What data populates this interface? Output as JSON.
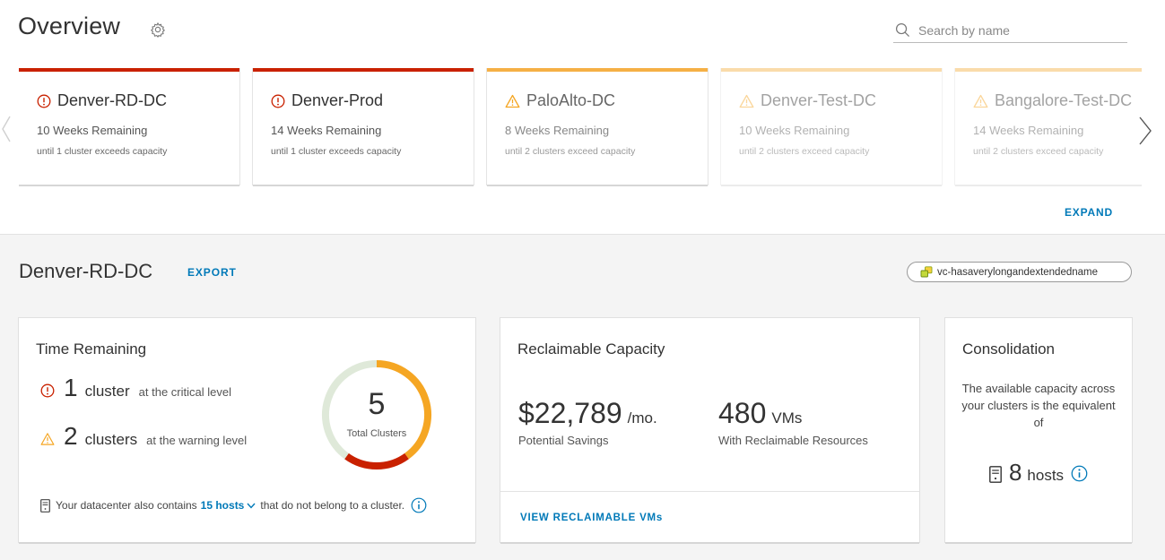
{
  "header": {
    "title": "Overview",
    "search": {
      "placeholder": "Search by name",
      "value": ""
    }
  },
  "datacenters": [
    {
      "name": "Denver-RD-DC",
      "status": "critical",
      "weeks": "10 Weeks Remaining",
      "detail": "until 1 cluster exceeds capacity"
    },
    {
      "name": "Denver-Prod",
      "status": "critical",
      "weeks": "14 Weeks Remaining",
      "detail": "until 1 cluster exceeds capacity"
    },
    {
      "name": "PaloAlto-DC",
      "status": "warning",
      "weeks": "8 Weeks Remaining",
      "detail": "until 2 clusters exceed capacity"
    },
    {
      "name": "Denver-Test-DC",
      "status": "warning",
      "weeks": "10 Weeks Remaining",
      "detail": "until 2 clusters exceed capacity"
    },
    {
      "name": "Bangalore-Test-DC",
      "status": "warning",
      "weeks": "14 Weeks Remaining",
      "detail": "until 2 clusters exceed capacity"
    }
  ],
  "expand_label": "EXPAND",
  "detail": {
    "title": "Denver-RD-DC",
    "export_label": "EXPORT",
    "vcenter_name": "vc-hasaverylongandextendedname"
  },
  "time_remaining": {
    "title": "Time Remaining",
    "critical": {
      "count": "1",
      "unit": "cluster",
      "level": "at the critical level"
    },
    "warning": {
      "count": "2",
      "unit": "clusters",
      "level": "at the warning level"
    },
    "total": "5",
    "total_label": "Total Clusters",
    "footnote_before": "Your datacenter also contains",
    "footnote_link": "15 hosts",
    "footnote_after": "that do not belong to a cluster."
  },
  "donut_segments": [
    {
      "status": "warning",
      "value": 2
    },
    {
      "status": "critical",
      "value": 1
    },
    {
      "status": "normal",
      "value": 2
    }
  ],
  "reclaimable": {
    "title": "Reclaimable Capacity",
    "savings_value": "$22,789",
    "savings_unit": "/mo.",
    "savings_label": "Potential Savings",
    "vms_value": "480",
    "vms_unit": "VMs",
    "vms_label": "With Reclaimable Resources",
    "view_label": "VIEW RECLAIMABLE VMs"
  },
  "consolidation": {
    "title": "Consolidation",
    "text": "The available capacity across your clusters is the equivalent of",
    "hosts_value": "8",
    "hosts_unit": "hosts"
  },
  "colors": {
    "critical": "#c92100",
    "warning": "#f5a623",
    "warning_border": "#f5b045",
    "normal": "#dfe9d9",
    "link": "#0079b8"
  },
  "icons": {
    "settings": "gear-icon",
    "search": "search-icon",
    "critical": "exclamation-circle-icon",
    "warning": "warning-triangle-icon",
    "next": "chevron-right-icon",
    "previous": "chevron-left-icon",
    "vcenter": "vcenter-icon",
    "host": "server-icon",
    "info": "info-circle-icon",
    "dropdown": "chevron-down-icon"
  }
}
